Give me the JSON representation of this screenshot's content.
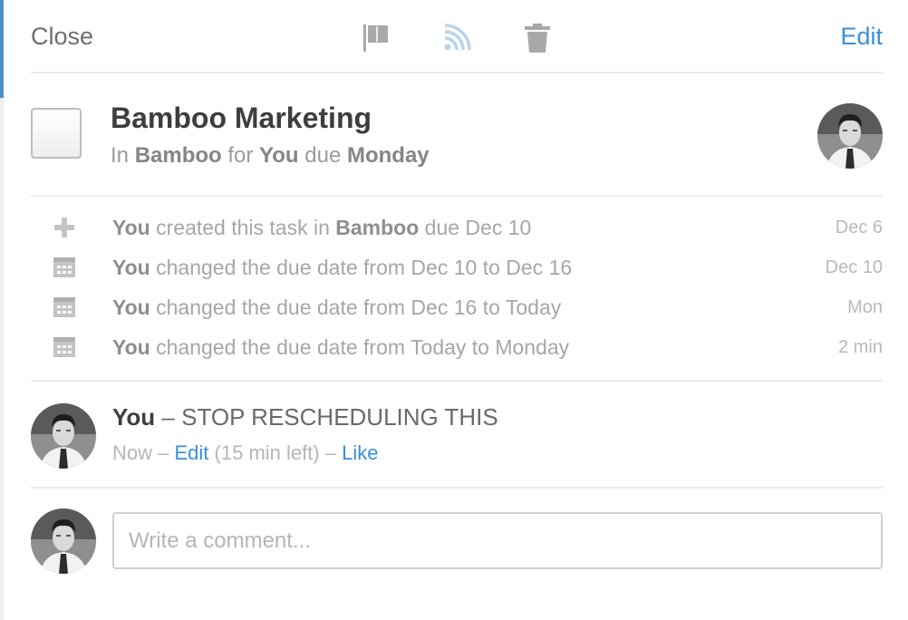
{
  "toolbar": {
    "close_label": "Close",
    "edit_label": "Edit",
    "icons": [
      "flag-icon",
      "rss-feed-icon",
      "trash-icon"
    ]
  },
  "task": {
    "title": "Bamboo Marketing",
    "sub_in": "In",
    "project": "Bamboo",
    "sub_for": "for",
    "assignee": "You",
    "sub_due": "due",
    "due": "Monday"
  },
  "activity": [
    {
      "icon": "plus-icon",
      "actor": "You",
      "text_a": "created this task in",
      "bold_b": "Bamboo",
      "text_c": "due Dec 10",
      "time": "Dec 6"
    },
    {
      "icon": "calendar-icon",
      "actor": "You",
      "text_a": "changed the due date from Dec 10 to Dec 16",
      "bold_b": "",
      "text_c": "",
      "time": "Dec 10"
    },
    {
      "icon": "calendar-icon",
      "actor": "You",
      "text_a": "changed the due date from Dec 16 to Today",
      "bold_b": "",
      "text_c": "",
      "time": "Mon"
    },
    {
      "icon": "calendar-icon",
      "actor": "You",
      "text_a": "changed the due date from Today to Monday",
      "bold_b": "",
      "text_c": "",
      "time": "2 min"
    }
  ],
  "comment": {
    "author": "You",
    "text": "– STOP RESCHEDULING THIS",
    "time": "Now –",
    "edit_label": "Edit",
    "edit_note": "(15 min left) –",
    "like_label": "Like"
  },
  "composer": {
    "placeholder": "Write a comment..."
  },
  "colors": {
    "accent": "#3a8fd8",
    "feed_icon": "#b9d4ee",
    "muted_icon": "#a8a8a8"
  }
}
